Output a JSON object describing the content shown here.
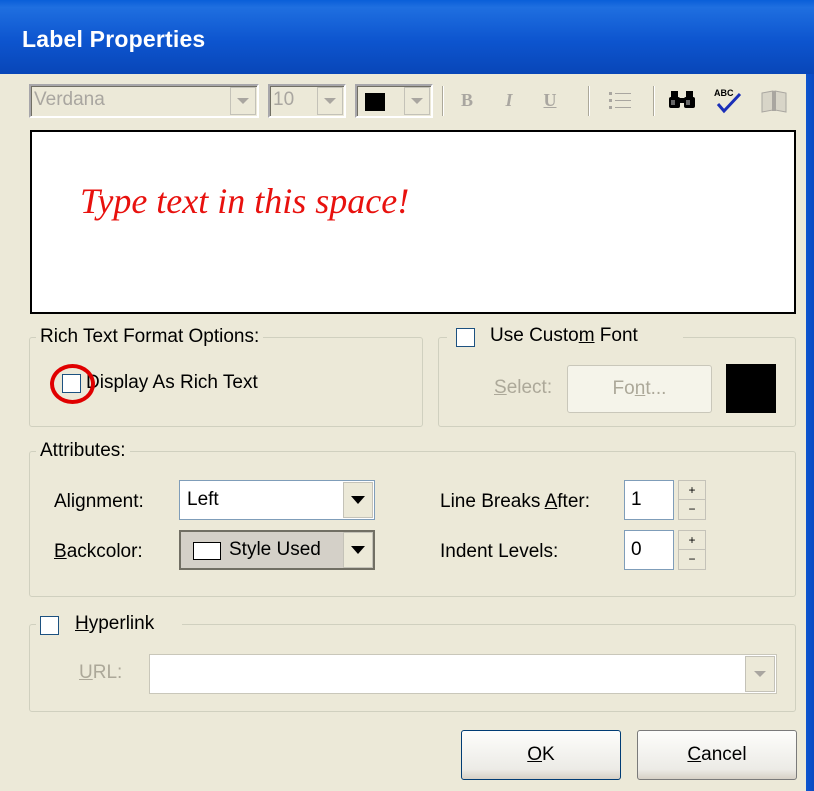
{
  "window": {
    "title": "Label Properties"
  },
  "toolbar": {
    "font_name": "Verdana",
    "font_size": "10",
    "color_swatch": "#000000",
    "bold_label": "B",
    "italic_label": "I",
    "underline_label": "U"
  },
  "editor": {
    "text": "Type text in this space!",
    "text_color": "#e8110e"
  },
  "rtf": {
    "group_label": "Rich Text Format Options:",
    "checkbox_label": "Display As Rich Text",
    "checked": false
  },
  "custom_font": {
    "group_label_pre": "Use Custo",
    "group_label_ul": "m",
    "group_label_post": " Font",
    "checked": false,
    "select_label_ul": "S",
    "select_label_post": "elect:",
    "font_btn_pre": "Fo",
    "font_btn_ul": "n",
    "font_btn_post": "t...",
    "color_swatch": "#000000"
  },
  "attributes": {
    "group_label": "Attributes:",
    "alignment_pre": "Ali",
    "alignment_ul": "g",
    "alignment_post": "nment:",
    "alignment_value": "Left",
    "backcolor_ul": "B",
    "backcolor_post": "ackcolor:",
    "backcolor_value": "Style Used",
    "line_breaks_pre": "Line Breaks ",
    "line_breaks_ul": "A",
    "line_breaks_post": "fter:",
    "line_breaks_value": "1",
    "indent_label": "Indent Levels:",
    "indent_value": "0"
  },
  "hyperlink": {
    "group_label_ul": "H",
    "group_label_post": "yperlink",
    "checked": false,
    "url_ul": "U",
    "url_post": "RL:",
    "url_value": ""
  },
  "buttons": {
    "ok_ul": "O",
    "ok_post": "K",
    "cancel_ul": "C",
    "cancel_post": "ancel"
  },
  "highlight_color": "#e00000"
}
